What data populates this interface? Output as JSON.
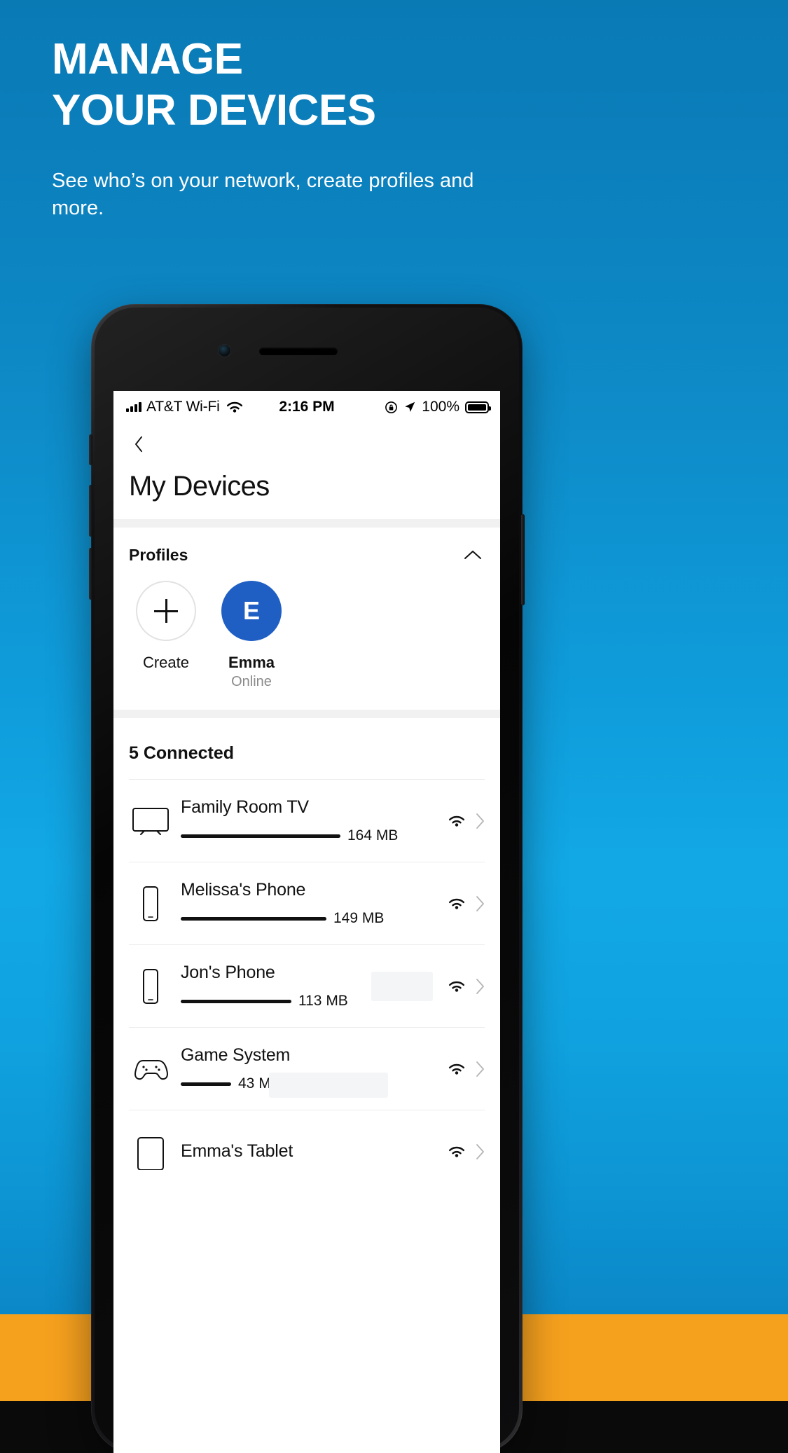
{
  "hero": {
    "title_line1": "MANAGE",
    "title_line2": "YOUR DEVICES",
    "subtitle": "See who’s on your network, create profiles and more."
  },
  "colors": {
    "bg_top": "#0a7ab5",
    "bg_mid": "#12a8e6",
    "bg_bottom_band": "#f6a11e",
    "accent_blue": "#1f5fc4",
    "text_dark": "#111111",
    "text_muted": "#8a8a8a"
  },
  "status_bar": {
    "carrier": "AT&T Wi-Fi",
    "signal_icon": "signal-bars-icon",
    "wifi_icon": "wifi-icon",
    "time": "2:16 PM",
    "rotation_lock_icon": "rotation-lock-icon",
    "location_icon": "location-arrow-icon",
    "battery_percent": "100%",
    "battery_icon": "battery-full-icon"
  },
  "app": {
    "back_icon": "chevron-left-icon",
    "page_title": "My Devices"
  },
  "profiles": {
    "section_title": "Profiles",
    "collapse_icon": "chevron-up-icon",
    "items": [
      {
        "type": "create",
        "icon": "plus-icon",
        "label": "Create",
        "status": "",
        "initial": "",
        "color": ""
      },
      {
        "type": "profile",
        "icon": "avatar-initial",
        "label": "Emma",
        "status": "Online",
        "initial": "E",
        "color": "#1f5fc4"
      }
    ]
  },
  "connected": {
    "header": "5 Connected",
    "devices": [
      {
        "name": "Family Room TV",
        "icon": "tv-icon",
        "usage": "164 MB",
        "bar_pct": 100,
        "wifi_icon": "wifi-icon",
        "chevron_icon": "chevron-right-icon"
      },
      {
        "name": "Melissa's Phone",
        "icon": "phone-icon",
        "usage": "149 MB",
        "bar_pct": 91,
        "wifi_icon": "wifi-icon",
        "chevron_icon": "chevron-right-icon"
      },
      {
        "name": "Jon's Phone",
        "icon": "phone-icon",
        "usage": "113 MB",
        "bar_pct": 69,
        "wifi_icon": "wifi-icon",
        "chevron_icon": "chevron-right-icon"
      },
      {
        "name": "Game System",
        "icon": "game-controller-icon",
        "usage": "43 MB",
        "bar_pct": 26,
        "wifi_icon": "wifi-icon",
        "chevron_icon": "chevron-right-icon"
      },
      {
        "name": "Emma's Tablet",
        "icon": "tablet-icon",
        "usage": "",
        "bar_pct": 0,
        "wifi_icon": "wifi-icon",
        "chevron_icon": "chevron-right-icon"
      }
    ]
  }
}
